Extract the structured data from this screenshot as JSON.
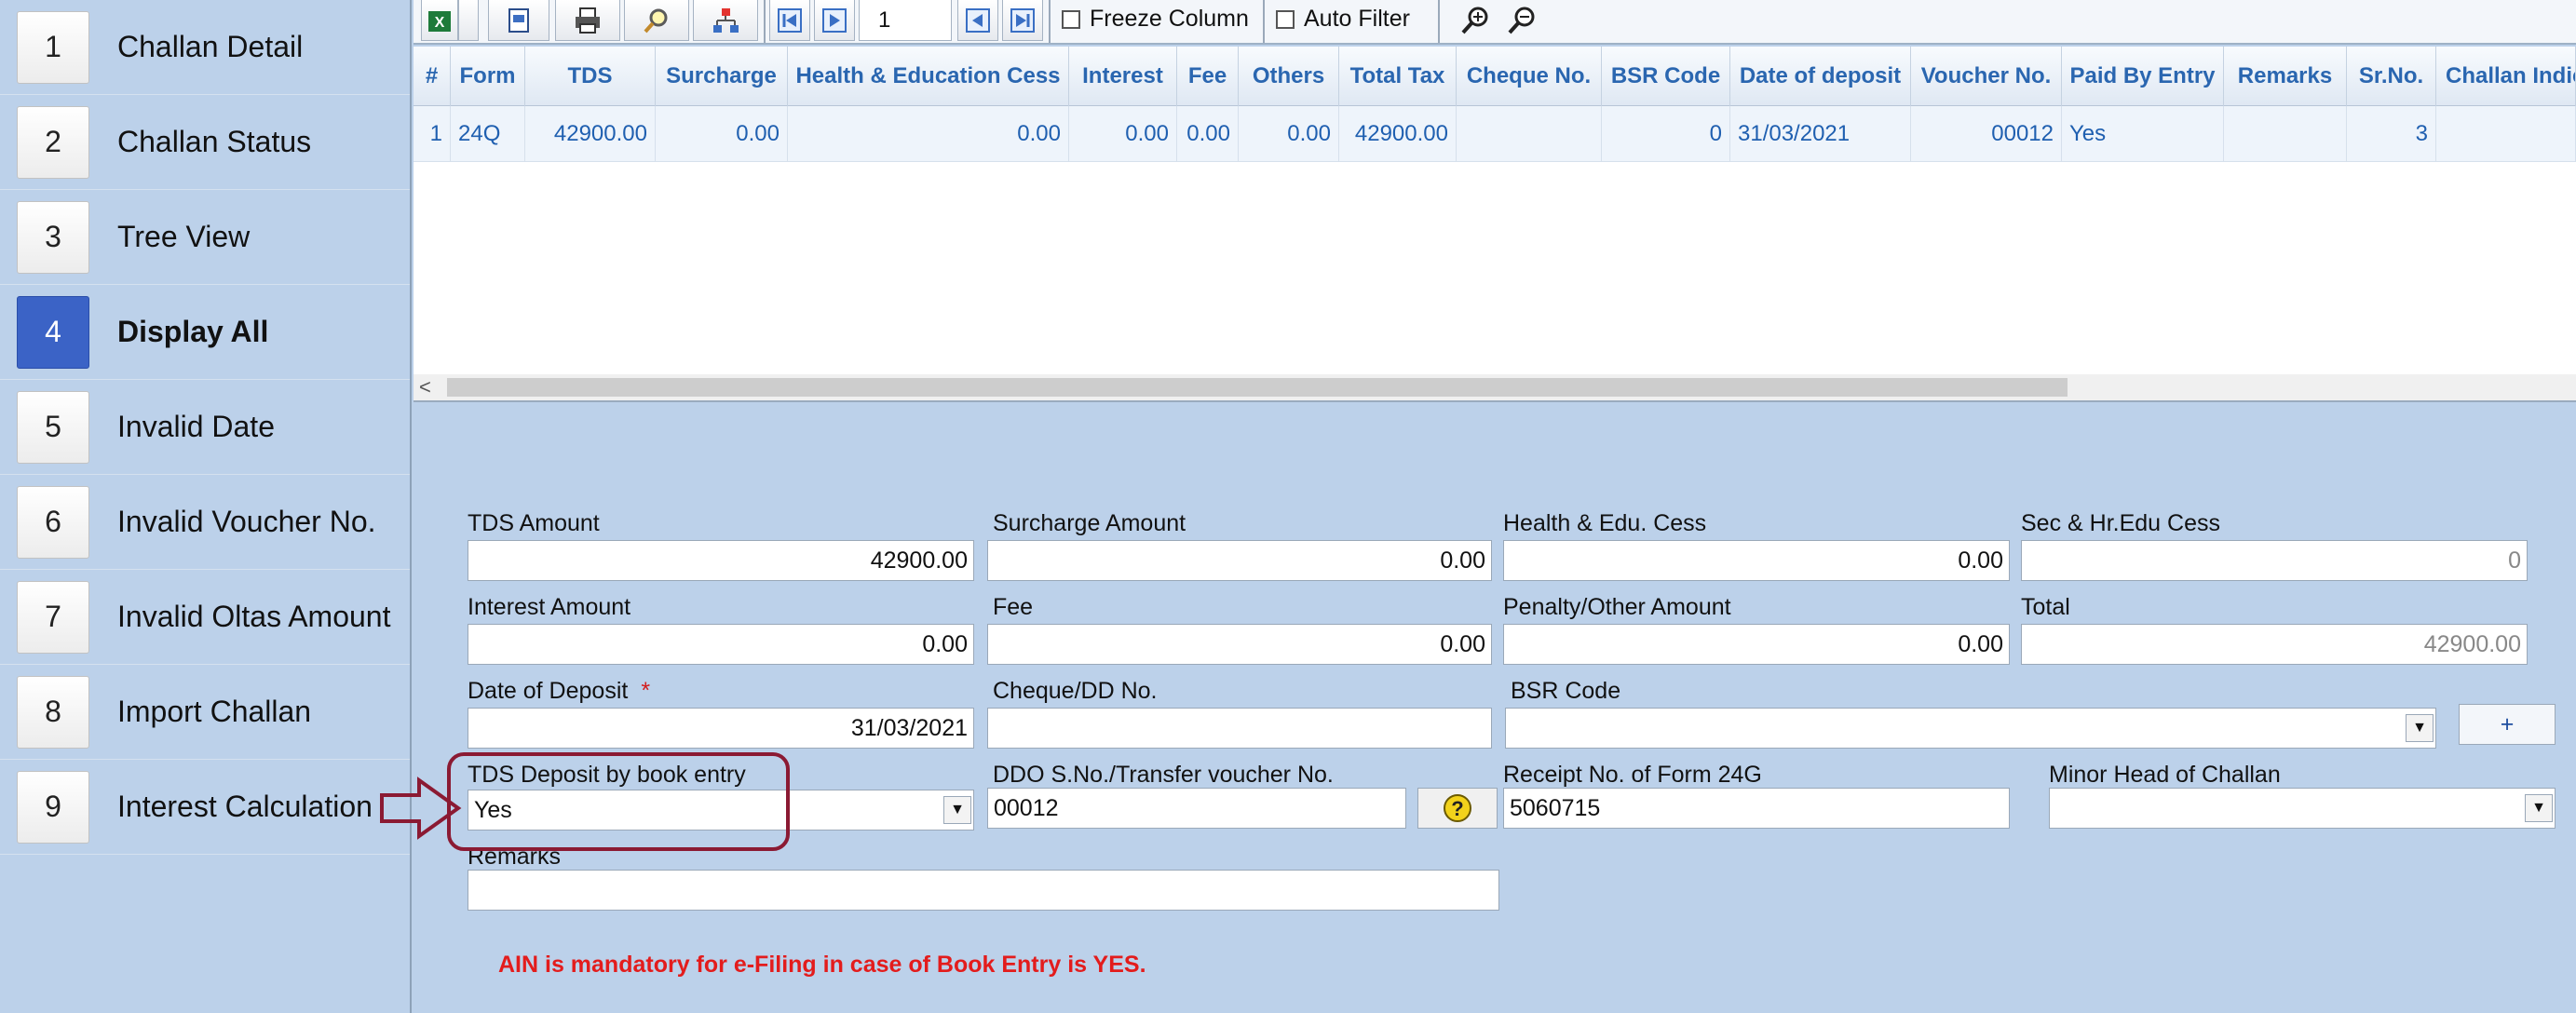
{
  "sidebar": {
    "items": [
      {
        "num": "1",
        "label": "Challan Detail"
      },
      {
        "num": "2",
        "label": "Challan Status"
      },
      {
        "num": "3",
        "label": "Tree View"
      },
      {
        "num": "4",
        "label": "Display All"
      },
      {
        "num": "5",
        "label": "Invalid Date"
      },
      {
        "num": "6",
        "label": "Invalid Voucher No."
      },
      {
        "num": "7",
        "label": "Invalid Oltas Amount"
      },
      {
        "num": "8",
        "label": "Import Challan"
      },
      {
        "num": "9",
        "label": "Interest Calculation"
      }
    ],
    "active_index": 3
  },
  "toolbar": {
    "page_number": "1",
    "freeze_column_label": "Freeze Column",
    "auto_filter_label": "Auto Filter",
    "freeze_column_checked": false,
    "auto_filter_checked": false
  },
  "grid": {
    "headers": [
      "#",
      "Form",
      "TDS",
      "Surcharge",
      "Health & Education Cess",
      "Interest",
      "Fee",
      "Others",
      "Total Tax",
      "Cheque No.",
      "BSR Code",
      "Date of deposit",
      "Voucher No.",
      "Paid By Entry",
      "Remarks",
      "Sr.No.",
      "Challan Indic"
    ],
    "rows": [
      [
        "1",
        "24Q",
        "42900.00",
        "0.00",
        "0.00",
        "0.00",
        "0.00",
        "0.00",
        "42900.00",
        "",
        "0",
        "31/03/2021",
        "00012",
        "Yes",
        "",
        "3",
        ""
      ]
    ]
  },
  "form": {
    "tds_amount": {
      "label": "TDS Amount",
      "value": "42900.00"
    },
    "surcharge_amount": {
      "label": "Surcharge Amount",
      "value": "0.00"
    },
    "health_edu_cess": {
      "label": "Health & Edu. Cess",
      "value": "0.00"
    },
    "sec_hr_edu_cess": {
      "label": "Sec & Hr.Edu Cess",
      "value": "0"
    },
    "interest_amount": {
      "label": "Interest Amount",
      "value": "0.00"
    },
    "fee": {
      "label": "Fee",
      "value": "0.00"
    },
    "penalty_other_amount": {
      "label": "Penalty/Other Amount",
      "value": "0.00"
    },
    "total": {
      "label": "Total",
      "value": "42900.00"
    },
    "date_of_deposit": {
      "label": "Date of Deposit",
      "required_mark": "*",
      "value": "31/03/2021"
    },
    "cheque_dd_no": {
      "label": "Cheque/DD No.",
      "value": ""
    },
    "bsr_code": {
      "label": "BSR Code",
      "value": ""
    },
    "add_button_label": "+",
    "tds_deposit_book_entry": {
      "label": "TDS Deposit by book entry",
      "value": "Yes"
    },
    "ddo_transfer_voucher": {
      "label": "DDO S.No./Transfer voucher No.",
      "value": "00012"
    },
    "receipt_form_24g": {
      "label": "Receipt No. of Form 24G",
      "value": "5060715"
    },
    "minor_head": {
      "label": "Minor Head of Challan",
      "value": ""
    },
    "remarks": {
      "label": "Remarks",
      "value": ""
    }
  },
  "warning_text": "AIN is mandatory for e-Filing in case of Book Entry is YES.",
  "colors": {
    "background": "#bcd1ea",
    "accent_active": "#3b63c6",
    "annotation": "#8b1a33",
    "warning": "#e31c1c",
    "grid_text": "#1f5fb0"
  }
}
